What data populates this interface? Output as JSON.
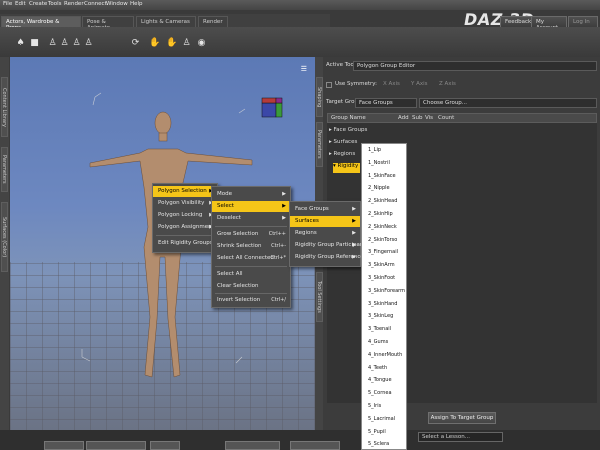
{
  "menubar": [
    "File",
    "Edit",
    "Create",
    "Tools",
    "Render",
    "Connect",
    "Window",
    "Help"
  ],
  "logo": "DAZ 3D",
  "top_buttons": {
    "feedback": "Feedback",
    "account": "My Account",
    "login": "Log In"
  },
  "tabs": [
    "Actors, Wardrobe & Props",
    "Pose & Animate",
    "Lights & Cameras",
    "Render"
  ],
  "left_tabs": [
    "Content Library",
    "Parameters",
    "Surfaces (Color)"
  ],
  "right_tabs": [
    "Shaping",
    "Parameters",
    "Tool Settings"
  ],
  "panel": {
    "active_tool_label": "Active Tool:",
    "active_tool_value": "Polygon Group Editor",
    "use_symmetry": "Use Symmetry:",
    "symmetry_options": [
      "X Axis",
      "Y Axis",
      "Z Axis"
    ],
    "target_group_label": "Target Group:",
    "target_group_value": "Face Groups",
    "choose_group": "Choose Group...",
    "columns": [
      "Group Name",
      "Add",
      "Sub",
      "Vis",
      "Count"
    ],
    "rows": [
      "Face Groups",
      "Surfaces",
      "Regions",
      "Rigidity"
    ],
    "assign_button": "Assign To Target Group"
  },
  "lesson_select": "Select a Lesson...",
  "context_menu": {
    "level1": [
      "Polygon Selection",
      "Polygon Visibility",
      "Polygon Locking",
      "Polygon Assignment",
      "Edit Rigidity Groups..."
    ],
    "level2": [
      {
        "label": "Mode",
        "shortcut": ""
      },
      {
        "label": "Select",
        "shortcut": ""
      },
      {
        "label": "Deselect",
        "shortcut": ""
      },
      {
        "label": "Grow Selection",
        "shortcut": "Ctrl++"
      },
      {
        "label": "Shrink Selection",
        "shortcut": "Ctrl+-"
      },
      {
        "label": "Select All Connected",
        "shortcut": "Ctrl+*"
      },
      {
        "label": "Select All",
        "shortcut": ""
      },
      {
        "label": "Clear Selection",
        "shortcut": ""
      },
      {
        "label": "Invert Selection",
        "shortcut": "Ctrl+/"
      }
    ],
    "level3": [
      "Face Groups",
      "Surfaces",
      "Regions",
      "Rigidity Group Participants",
      "Rigidity Group References"
    ],
    "surfaces": [
      "1_Lip",
      "1_Nostril",
      "1_SkinFace",
      "2_Nipple",
      "2_SkinHead",
      "2_SkinHip",
      "2_SkinNeck",
      "2_SkinTorso",
      "3_Fingernail",
      "3_SkinArm",
      "3_SkinFoot",
      "3_SkinForearm",
      "3_SkinHand",
      "3_SkinLeg",
      "3_Toenail",
      "4_Gums",
      "4_InnerMouth",
      "4_Teeth",
      "4_Tongue",
      "5_Cornea",
      "5_Iris",
      "5_Lacrimal",
      "5_Pupil",
      "5_Sclera",
      "6_Eyelash"
    ]
  },
  "colors": {
    "highlight": "#f5c518",
    "viewport_bg": "#6d88c0",
    "menu_bg": "#4a4a4a"
  },
  "icons": [
    "wardrobe-icon",
    "prop-icon",
    "figure-icon",
    "figure-add-icon",
    "figure-remove-icon",
    "figure-group-icon",
    "rotate-icon",
    "grab-icon",
    "hand-icon",
    "pose-icon",
    "region-icon"
  ]
}
